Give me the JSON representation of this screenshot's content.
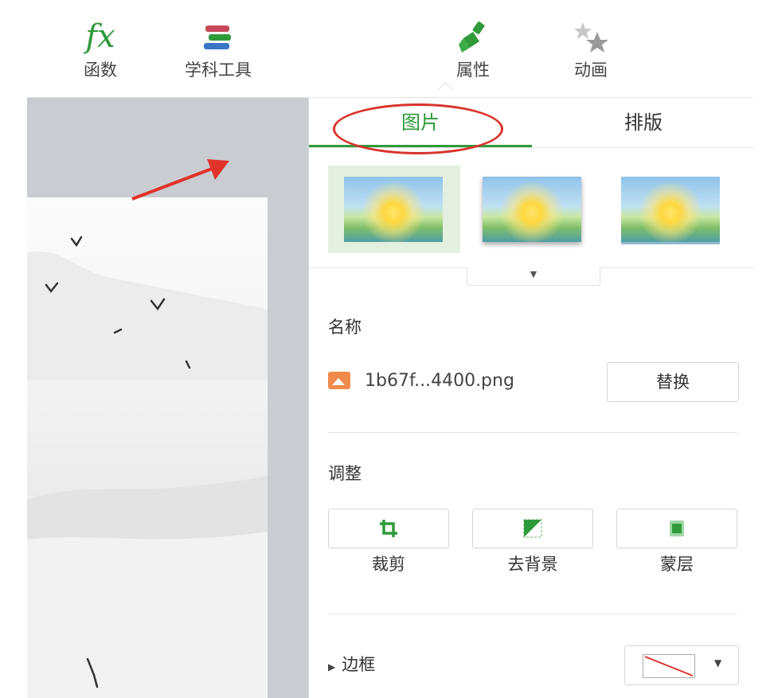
{
  "toolbar": {
    "fx_label": "函数",
    "fx_glyph": "fx",
    "subject_tools_label": "学科工具",
    "properties_label": "属性",
    "animation_label": "动画"
  },
  "panel": {
    "tabs": [
      {
        "label": "图片",
        "active": true
      },
      {
        "label": "排版",
        "active": false
      }
    ],
    "name_section": {
      "title": "名称",
      "file_name": "1b67f...4400.png",
      "replace_label": "替换"
    },
    "adjust_section": {
      "title": "调整",
      "buttons": [
        {
          "label": "裁剪",
          "icon": "crop-icon"
        },
        {
          "label": "去背景",
          "icon": "remove-background-icon"
        },
        {
          "label": "蒙层",
          "icon": "mask-layer-icon"
        }
      ]
    },
    "border_section": {
      "label": "边框",
      "value": "none"
    }
  },
  "colors": {
    "accent": "#2e9a3a",
    "annotation_red": "#d9332b",
    "canvas_bg": "#c9ccd1",
    "file_icon": "#f08a4b"
  }
}
